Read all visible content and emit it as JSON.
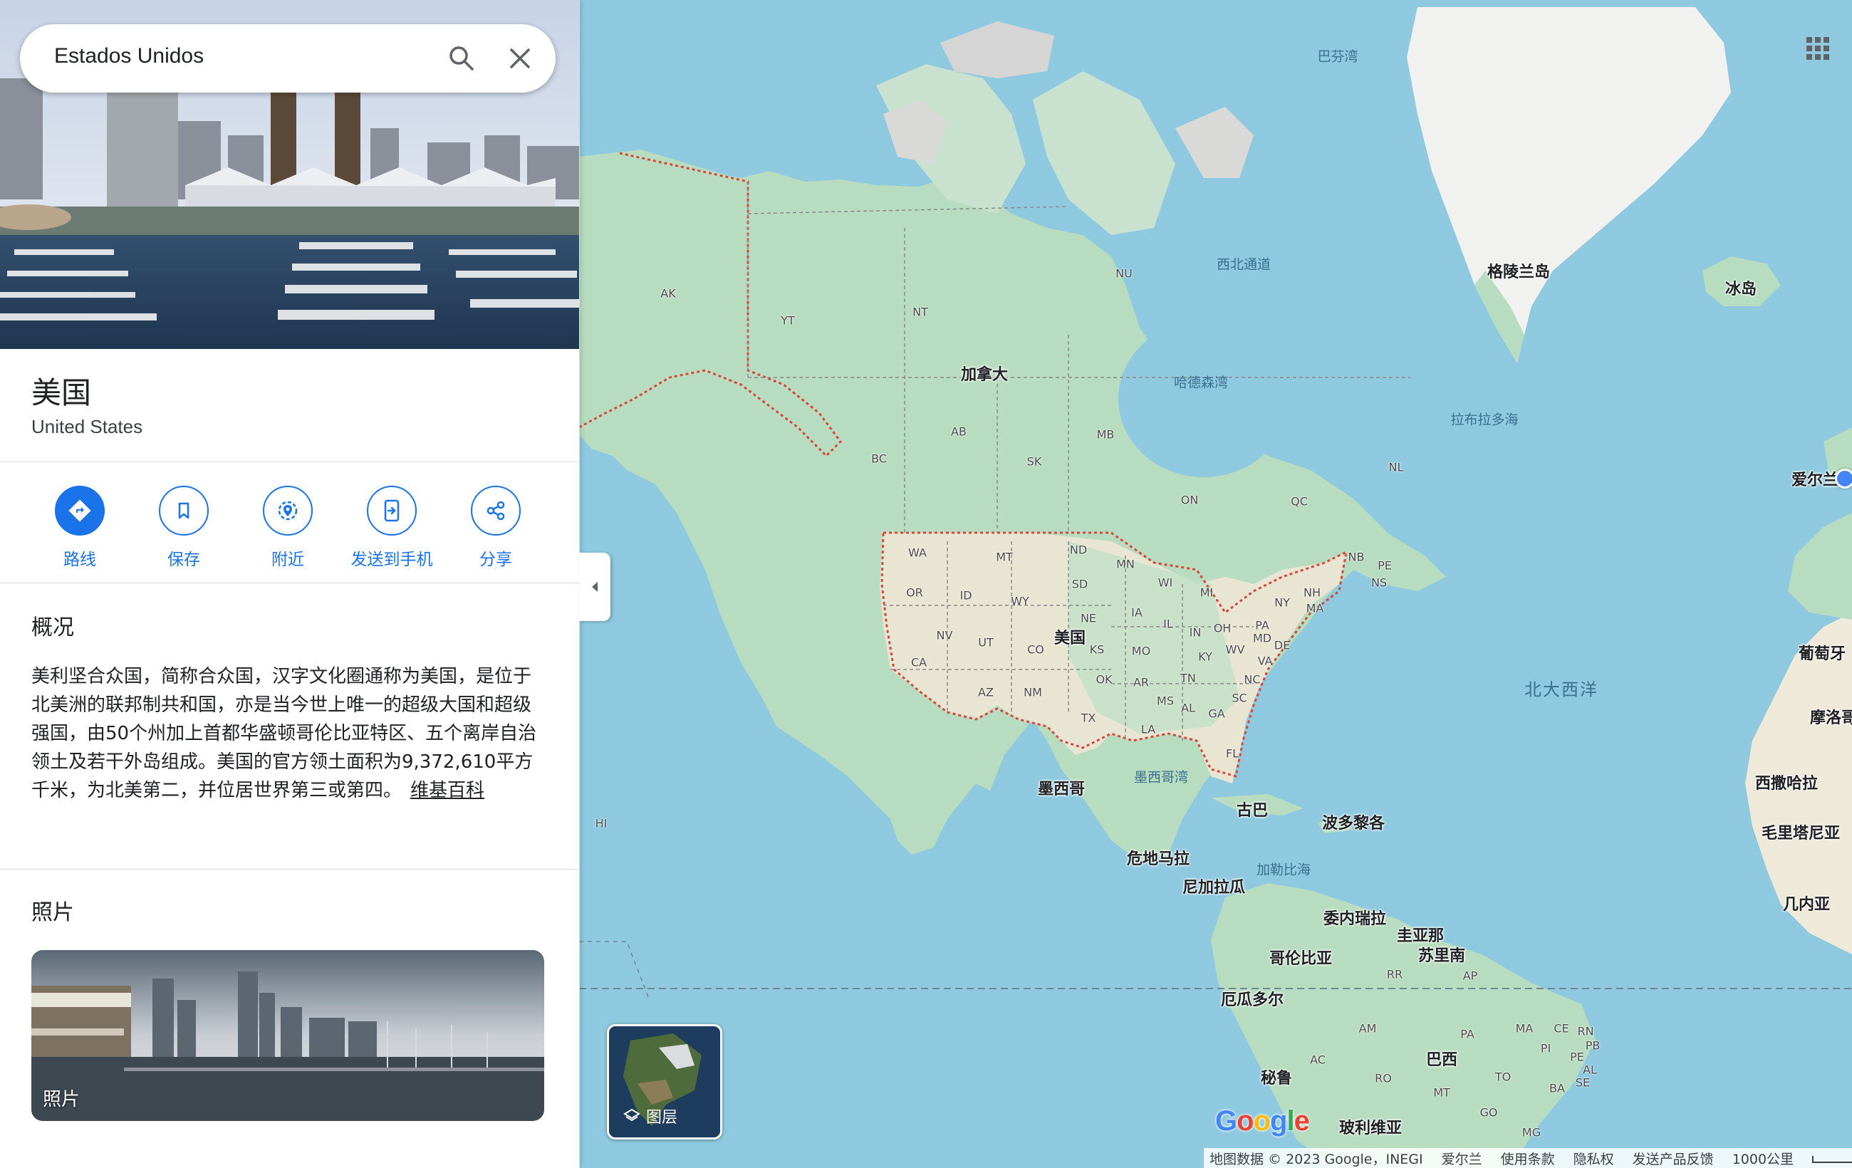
{
  "search": {
    "query": "Estados Unidos"
  },
  "place": {
    "title": "美国",
    "subtitle": "United States"
  },
  "actions": [
    {
      "label": "路线",
      "icon": "directions-icon"
    },
    {
      "label": "保存",
      "icon": "bookmark-icon"
    },
    {
      "label": "附近",
      "icon": "nearby-icon"
    },
    {
      "label": "发送到手机",
      "icon": "send-to-phone-icon"
    },
    {
      "label": "分享",
      "icon": "share-icon"
    }
  ],
  "overview": {
    "heading": "概况",
    "text": "美利坚合众国，简称合众国，汉字文化圈通称为美国，是位于北美洲的联邦制共和国，亦是当今世上唯一的超级大国和超级强国，由50个州加上首都华盛顿哥伦比亚特区、五个离岸自治领土及若干外岛组成。美国的官方领土面积为9,372,610平方千米，为北美第二，并位居世界第三或第四。",
    "link": "维基百科"
  },
  "photos": {
    "heading": "照片",
    "card_label": "照片"
  },
  "layers": {
    "label": "图层"
  },
  "google_logo": "Google",
  "footer": {
    "copyright": "地图数据 © 2023 Google，INEGI",
    "region": "爱尔兰",
    "terms": "使用条款",
    "privacy": "隐私权",
    "feedback": "发送产品反馈",
    "scale": "1000公里"
  },
  "map_labels": {
    "countries": [
      "加拿大",
      "美国",
      "格陵兰岛",
      "冰岛",
      "墨西哥",
      "古巴",
      "波多黎各",
      "危地马拉",
      "尼加拉瓜",
      "委内瑞拉",
      "圭亚那",
      "苏里南",
      "哥伦比亚",
      "厄瓜多尔",
      "巴西",
      "秘鲁",
      "玻利维亚",
      "爱尔兰",
      "葡萄牙",
      "摩洛哥",
      "西撒哈拉",
      "毛里塔尼亚",
      "几内亚"
    ],
    "waters": [
      "巴芬湾",
      "西北通道",
      "哈德森湾",
      "拉布拉多海",
      "墨西哥湾",
      "加勒比海"
    ],
    "ocean": "北大西洋",
    "states": [
      "AK",
      "YT",
      "NT",
      "NU",
      "BC",
      "AB",
      "SK",
      "MB",
      "ON",
      "QC",
      "NL",
      "NB",
      "PE",
      "NS",
      "WA",
      "MT",
      "ND",
      "MN",
      "OR",
      "ID",
      "WY",
      "SD",
      "WI",
      "MI",
      "NY",
      "NE",
      "IA",
      "IL",
      "IN",
      "OH",
      "PA",
      "NH",
      "MA",
      "NV",
      "UT",
      "CO",
      "KS",
      "MO",
      "KY",
      "WV",
      "MD",
      "DE",
      "VA",
      "CA",
      "AZ",
      "NM",
      "OK",
      "AR",
      "TN",
      "NC",
      "SC",
      "MS",
      "AL",
      "GA",
      "TX",
      "LA",
      "FL",
      "HI",
      "RR",
      "AP",
      "AM",
      "PA",
      "MA",
      "CE",
      "RN",
      "PB",
      "PI",
      "PE",
      "AL",
      "SE",
      "AC",
      "RO",
      "TO",
      "MT",
      "BA",
      "GO",
      "MG"
    ]
  },
  "colors": {
    "water": "#8ec9df",
    "land_green": "#b7dcbf",
    "land_tan": "#efe9d9",
    "ice": "#f4f4f4",
    "accent": "#1a73e8",
    "border_red": "#d9473c"
  }
}
